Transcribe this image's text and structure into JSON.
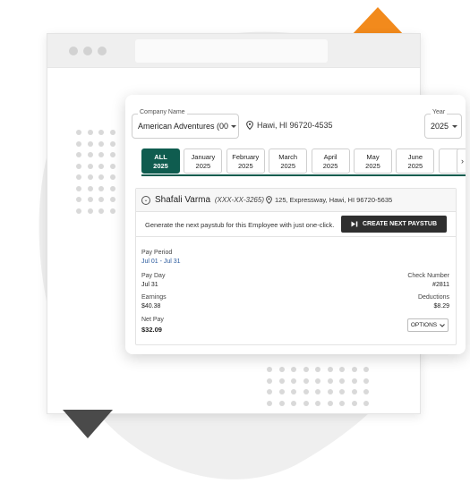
{
  "filters": {
    "company": {
      "label": "Company Name",
      "value": "American Adventures (00"
    },
    "location": "Hawi, HI 96720-4535",
    "year": {
      "label": "Year",
      "value": "2025"
    }
  },
  "months": [
    {
      "name": "ALL",
      "year": "2025",
      "active": true
    },
    {
      "name": "January",
      "year": "2025"
    },
    {
      "name": "February",
      "year": "2025"
    },
    {
      "name": "March",
      "year": "2025"
    },
    {
      "name": "April",
      "year": "2025"
    },
    {
      "name": "May",
      "year": "2025"
    },
    {
      "name": "June",
      "year": "2025"
    },
    {
      "name": "",
      "year": ""
    }
  ],
  "next_arrow": "›",
  "employee": {
    "name": "Shafali Varma",
    "ssn": "(XXX-XX-3265)",
    "address": "125, Expressway, Hawi, HI 96720-5635"
  },
  "prompt": {
    "text": "Generate the next paystub for this Employee with just one-click.",
    "button": "CREATE NEXT PAYSTUB",
    "button_icon": "skip-next-icon"
  },
  "paystub": {
    "pay_period_label": "Pay Period",
    "pay_period": "Jul 01 - Jul 31",
    "pay_day_label": "Pay Day",
    "pay_day": "Jul 31",
    "check_number_label": "Check Number",
    "check_number": "#2811",
    "earnings_label": "Earnings",
    "earnings": "$40.38",
    "deductions_label": "Deductions",
    "deductions": "$8.29",
    "net_pay_label": "Net Pay",
    "net_pay": "$32.09",
    "options_label": "OPTIONS"
  },
  "colors": {
    "accent": "#0f5c4f",
    "orange": "#f28a1c",
    "button": "#2f2f2f"
  }
}
